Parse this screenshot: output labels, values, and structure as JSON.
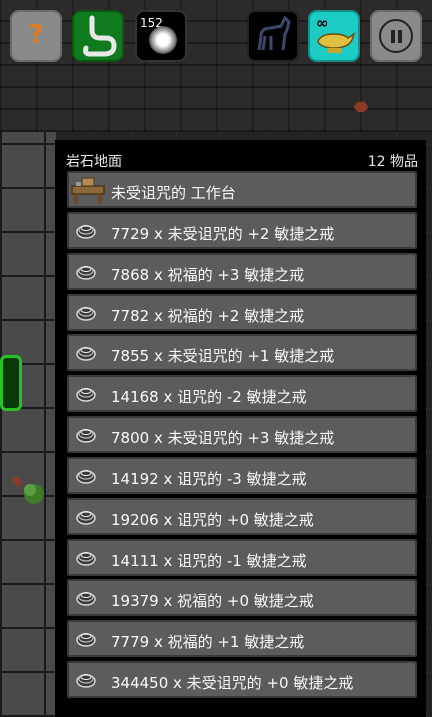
{
  "hud": {
    "help_icon": "question-mark",
    "light_count": "152",
    "lamp_label": "∞"
  },
  "panel": {
    "title": "岩石地面",
    "count": "12 物品",
    "items": [
      {
        "label": "未受诅咒的 工作台",
        "icon": "workbench"
      },
      {
        "label": "7729 x 未受诅咒的 +2 敏捷之戒",
        "icon": "ring"
      },
      {
        "label": "7868 x 祝福的 +3 敏捷之戒",
        "icon": "ring"
      },
      {
        "label": "7782 x 祝福的 +2 敏捷之戒",
        "icon": "ring"
      },
      {
        "label": "7855 x 未受诅咒的 +1 敏捷之戒",
        "icon": "ring"
      },
      {
        "label": "14168 x 诅咒的 -2 敏捷之戒",
        "icon": "ring"
      },
      {
        "label": "7800 x 未受诅咒的 +3 敏捷之戒",
        "icon": "ring"
      },
      {
        "label": "14192 x 诅咒的 -3 敏捷之戒",
        "icon": "ring"
      },
      {
        "label": "19206 x 诅咒的 +0 敏捷之戒",
        "icon": "ring"
      },
      {
        "label": "14111 x 诅咒的 -1 敏捷之戒",
        "icon": "ring"
      },
      {
        "label": "19379 x 祝福的 +0 敏捷之戒",
        "icon": "ring"
      },
      {
        "label": "7779 x 祝福的 +1 敏捷之戒",
        "icon": "ring"
      },
      {
        "label": "344450 x 未受诅咒的 +0 敏捷之戒",
        "icon": "ring"
      }
    ]
  }
}
